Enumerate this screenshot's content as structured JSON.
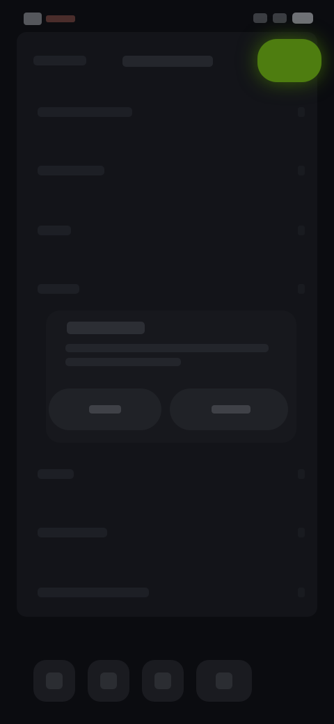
{
  "theme": {
    "background": "#0b0c10",
    "panel": "#131419",
    "accent": "#4e7d10",
    "status_tint": "#4a2d2b"
  },
  "status_bar": {
    "icons": [
      "app-logo-icon",
      "signal-icon",
      "wifi-icon",
      "battery-icon"
    ]
  },
  "header": {
    "back_icon": "chevron-left-icon",
    "action_icon": "check-icon"
  },
  "rows": [
    {
      "icon": "chevron-right-icon"
    },
    {
      "icon": "chevron-right-icon"
    },
    {
      "icon": "chevron-right-icon"
    },
    {
      "icon": "chevron-right-icon"
    },
    {
      "icon": "chevron-right-icon"
    },
    {
      "icon": "chevron-right-icon"
    },
    {
      "icon": "chevron-right-icon"
    }
  ],
  "dialog": {
    "visible": true
  },
  "tab_bar": {
    "icons": [
      "home-icon",
      "search-icon",
      "library-icon",
      "profile-icon"
    ]
  }
}
